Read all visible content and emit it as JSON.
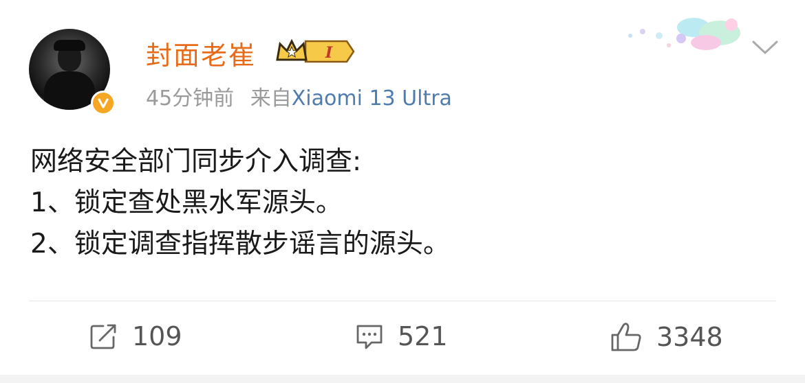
{
  "user": {
    "name": "封面老崔",
    "vip_level": "I",
    "timestamp": "45分钟前",
    "source_prefix": "来自",
    "device": "Xiaomi 13 Ultra"
  },
  "post": {
    "lines": [
      "网络安全部门同步介入调查:",
      "1、锁定查处黑水军源头。",
      "2、锁定调查指挥散步谣言的源头。"
    ]
  },
  "actions": {
    "reposts": "109",
    "comments": "521",
    "likes": "3348"
  },
  "colors": {
    "username": "#e86b1a",
    "device": "#4f7cae",
    "verified_badge": "#f5a623"
  },
  "icons": [
    "avatar",
    "verified-badge-icon",
    "vip-crown-icon",
    "chevron-down-icon",
    "repost-icon",
    "comment-icon",
    "like-icon"
  ]
}
